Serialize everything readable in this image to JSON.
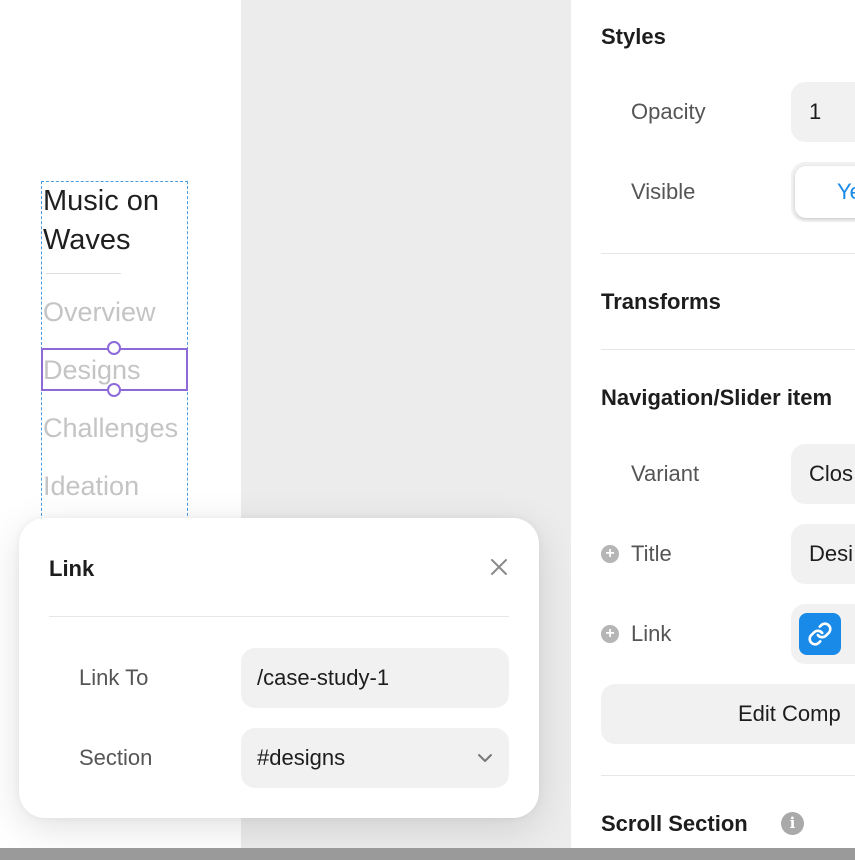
{
  "canvas": {
    "nav_title": "Music on Waves",
    "nav_items": [
      "Overview",
      "Designs",
      "Challenges",
      "Ideation"
    ]
  },
  "link_popover": {
    "title": "Link",
    "link_to_label": "Link To",
    "link_to_value": "/case-study-1",
    "section_label": "Section",
    "section_value": "#designs"
  },
  "panel": {
    "styles_title": "Styles",
    "opacity_label": "Opacity",
    "opacity_value": "1",
    "visible_label": "Visible",
    "visible_value": "Ye",
    "transforms_title": "Transforms",
    "nav_section_title": "Navigation/Slider item",
    "variant_label": "Variant",
    "variant_value": "Clos",
    "title_label": "Title",
    "title_value": "Desi",
    "link_label": "Link",
    "edit_button": "Edit Comp",
    "scroll_section_title": "Scroll Section"
  },
  "colors": {
    "accent_blue": "#1a8ae8",
    "selection_purple": "#8e6ad8",
    "frame_dashed_blue": "#4a9be0"
  }
}
